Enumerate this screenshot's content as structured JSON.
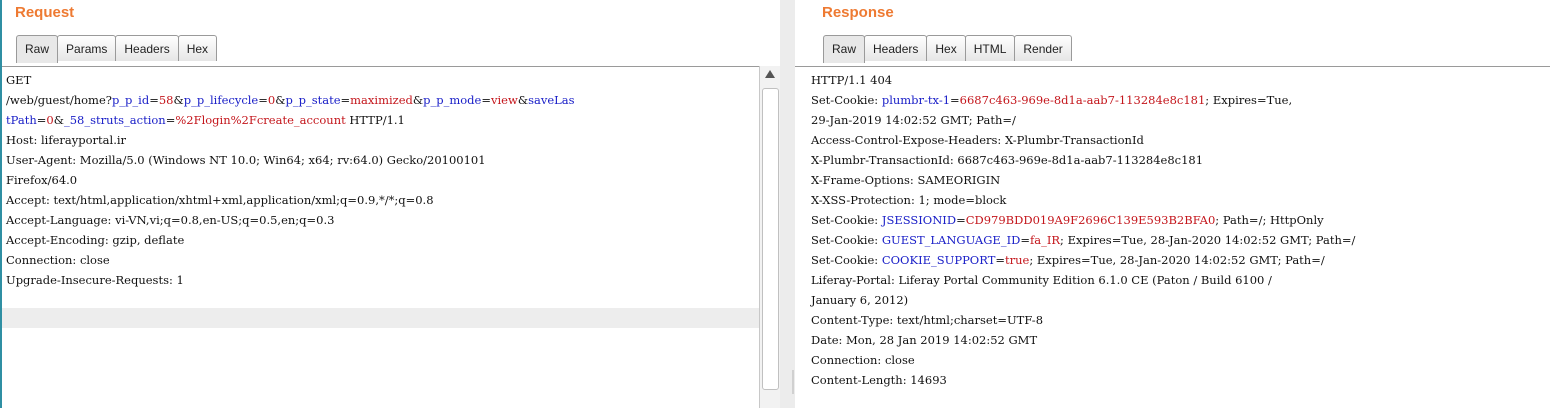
{
  "request": {
    "title": "Request",
    "tabs": [
      "Raw",
      "Params",
      "Headers",
      "Hex"
    ],
    "lines": [
      [
        {
          "t": "GET"
        }
      ],
      [
        {
          "t": "/web/guest/home?"
        },
        {
          "t": "p_p_id",
          "c": "k"
        },
        {
          "t": "="
        },
        {
          "t": "58",
          "c": "v"
        },
        {
          "t": "&"
        },
        {
          "t": "p_p_lifecycle",
          "c": "k"
        },
        {
          "t": "="
        },
        {
          "t": "0",
          "c": "v"
        },
        {
          "t": "&"
        },
        {
          "t": "p_p_state",
          "c": "k"
        },
        {
          "t": "="
        },
        {
          "t": "maximized",
          "c": "v"
        },
        {
          "t": "&"
        },
        {
          "t": "p_p_mode",
          "c": "k"
        },
        {
          "t": "="
        },
        {
          "t": "view",
          "c": "v"
        },
        {
          "t": "&"
        },
        {
          "t": "saveLas",
          "c": "k"
        }
      ],
      [
        {
          "t": "tPath",
          "c": "k"
        },
        {
          "t": "="
        },
        {
          "t": "0",
          "c": "v"
        },
        {
          "t": "&"
        },
        {
          "t": "_58_struts_action",
          "c": "k"
        },
        {
          "t": "="
        },
        {
          "t": "%2Flogin%2Fcreate_account",
          "c": "v"
        },
        {
          "t": " HTTP/1.1"
        }
      ],
      [
        {
          "t": "Host: liferayportal.ir"
        }
      ],
      [
        {
          "t": "User-Agent: Mozilla/5.0 (Windows NT 10.0; Win64; x64; rv:64.0) Gecko/20100101"
        }
      ],
      [
        {
          "t": "Firefox/64.0"
        }
      ],
      [
        {
          "t": "Accept: text/html,application/xhtml+xml,application/xml;q=0.9,*/*;q=0.8"
        }
      ],
      [
        {
          "t": "Accept-Language: vi-VN,vi;q=0.8,en-US;q=0.5,en;q=0.3"
        }
      ],
      [
        {
          "t": "Accept-Encoding: gzip, deflate"
        }
      ],
      [
        {
          "t": "Connection: close"
        }
      ],
      [
        {
          "t": "Upgrade-Insecure-Requests: 1"
        }
      ]
    ]
  },
  "response": {
    "title": "Response",
    "tabs": [
      "Raw",
      "Headers",
      "Hex",
      "HTML",
      "Render"
    ],
    "lines": [
      [
        {
          "t": "HTTP/1.1 404"
        }
      ],
      [
        {
          "t": "Set-Cookie: "
        },
        {
          "t": "plumbr-tx-1",
          "c": "k"
        },
        {
          "t": "="
        },
        {
          "t": "6687c463-969e-8d1a-aab7-113284e8c181",
          "c": "v"
        },
        {
          "t": "; Expires=Tue,"
        }
      ],
      [
        {
          "t": "29-Jan-2019 14:02:52 GMT; Path=/"
        }
      ],
      [
        {
          "t": "Access-Control-Expose-Headers: X-Plumbr-TransactionId"
        }
      ],
      [
        {
          "t": "X-Plumbr-TransactionId: 6687c463-969e-8d1a-aab7-113284e8c181"
        }
      ],
      [
        {
          "t": "X-Frame-Options: SAMEORIGIN"
        }
      ],
      [
        {
          "t": "X-XSS-Protection: 1; mode=block"
        }
      ],
      [
        {
          "t": "Set-Cookie: "
        },
        {
          "t": "JSESSIONID",
          "c": "k"
        },
        {
          "t": "="
        },
        {
          "t": "CD979BDD019A9F2696C139E593B2BFA0",
          "c": "v"
        },
        {
          "t": "; Path=/; HttpOnly"
        }
      ],
      [
        {
          "t": "Set-Cookie: "
        },
        {
          "t": "GUEST_LANGUAGE_ID",
          "c": "k"
        },
        {
          "t": "="
        },
        {
          "t": "fa_IR",
          "c": "v"
        },
        {
          "t": "; Expires=Tue, 28-Jan-2020 14:02:52 GMT; Path=/"
        }
      ],
      [
        {
          "t": "Set-Cookie: "
        },
        {
          "t": "COOKIE_SUPPORT",
          "c": "k"
        },
        {
          "t": "="
        },
        {
          "t": "true",
          "c": "v"
        },
        {
          "t": "; Expires=Tue, 28-Jan-2020 14:02:52 GMT; Path=/"
        }
      ],
      [
        {
          "t": "Liferay-Portal: Liferay Portal Community Edition 6.1.0 CE (Paton / Build 6100 /"
        }
      ],
      [
        {
          "t": "January 6, 2012)"
        }
      ],
      [
        {
          "t": "Content-Type: text/html;charset=UTF-8"
        }
      ],
      [
        {
          "t": "Date: Mon, 28 Jan 2019 14:02:52 GMT"
        }
      ],
      [
        {
          "t": "Connection: close"
        }
      ],
      [
        {
          "t": "Content-Length: 14693"
        }
      ]
    ]
  },
  "colors": {
    "title": "#ee7a32",
    "param_name": "#1b20c8",
    "param_value": "#c4161c"
  },
  "icons": {
    "scroll_up": "triangle-up"
  }
}
